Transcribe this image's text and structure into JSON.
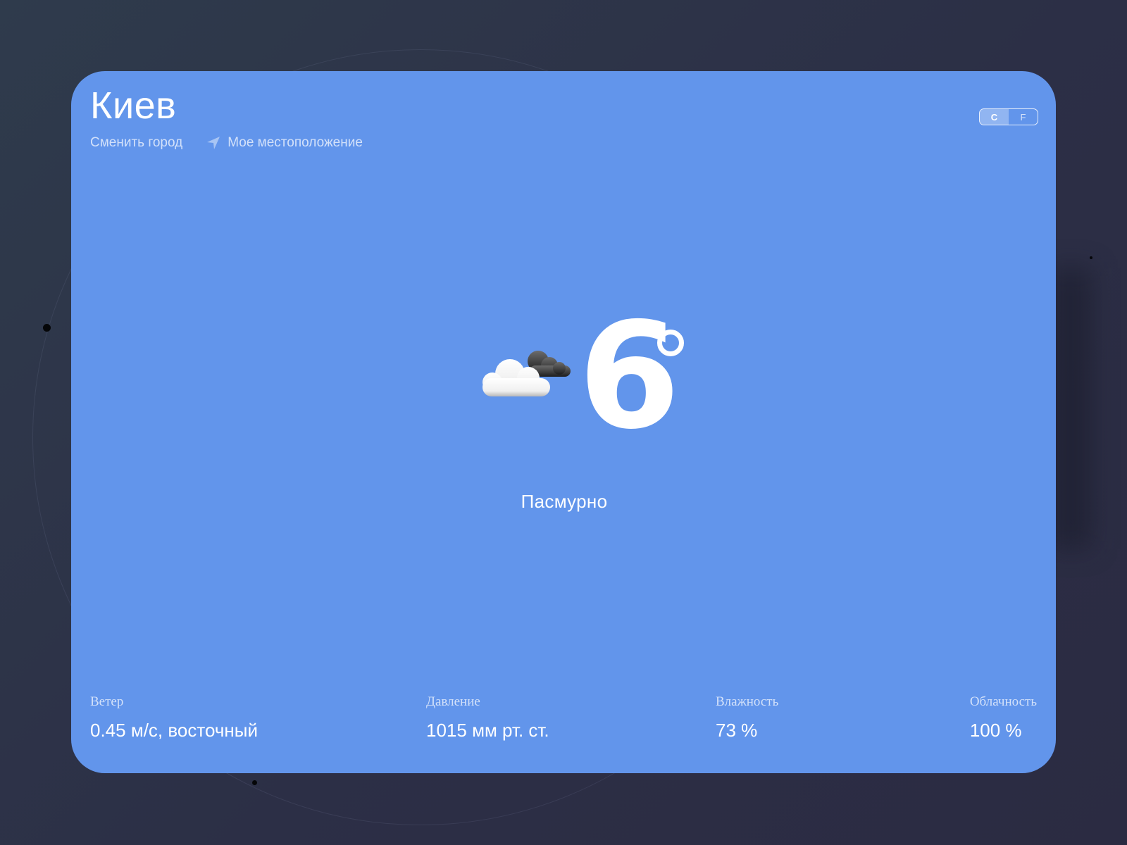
{
  "city": "Киев",
  "header": {
    "change_city": "Сменить город",
    "my_location": "Мое местоположение"
  },
  "units": {
    "celsius": "C",
    "fahrenheit": "F",
    "active": "C"
  },
  "current": {
    "temperature": "6",
    "description": "Пасмурно",
    "icon": "cloud-icon"
  },
  "stats": {
    "wind": {
      "label": "Ветер",
      "value": "0.45 м/с, восточный"
    },
    "pressure": {
      "label": "Давление",
      "value": "1015 мм рт. ст."
    },
    "humidity": {
      "label": "Влажность",
      "value": "73 %"
    },
    "cloudiness": {
      "label": "Облачность",
      "value": "100 %"
    }
  },
  "colors": {
    "background": "#2c2f46",
    "card": "#6295eb",
    "text": "#ffffff"
  }
}
